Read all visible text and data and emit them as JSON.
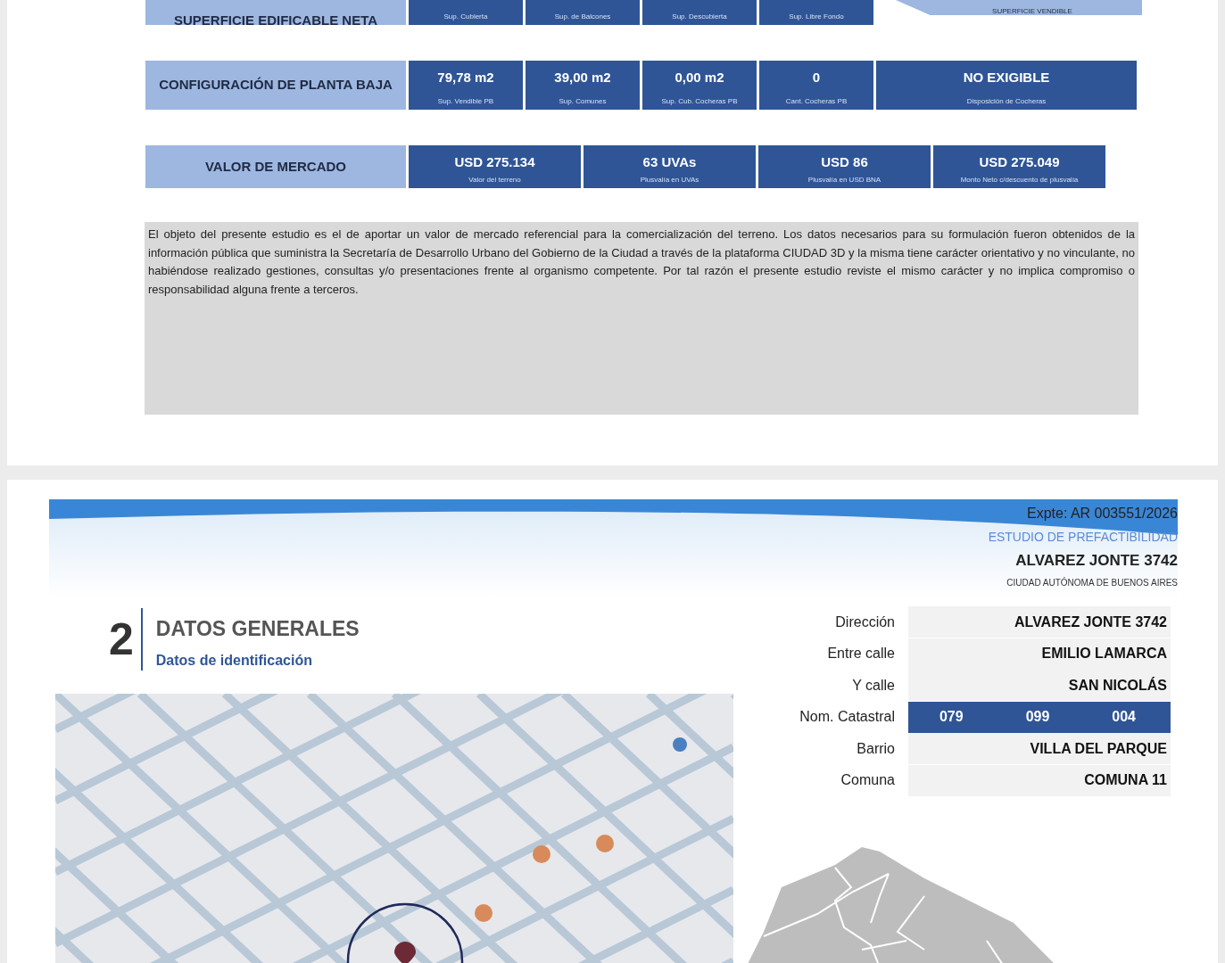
{
  "summary_rows": [
    {
      "label": "SUPERFICIE EDIFICABLE NETA",
      "cells": [
        {
          "caption": "Sup. Cubierta"
        },
        {
          "caption": "Sup. de Balcones"
        },
        {
          "caption": "Sup. Descubierta"
        },
        {
          "caption": "Sup. Libre Fondo"
        }
      ],
      "tag": "SUPERFICIE VENDIBLE"
    },
    {
      "label": "CONFIGURACIÓN DE PLANTA BAJA",
      "cells": [
        {
          "value": "79,78 m2",
          "caption": "Sup. Vendible PB"
        },
        {
          "value": "39,00 m2",
          "caption": "Sup. Comunes"
        },
        {
          "value": "0,00 m2",
          "caption": "Sup. Cub. Cocheras  PB"
        },
        {
          "value": "0",
          "caption": "Cant. Cocheras PB"
        },
        {
          "value": "NO EXIGIBLE",
          "caption": "Disposición de Cocheras"
        }
      ]
    },
    {
      "label": "VALOR DE MERCADO",
      "cells": [
        {
          "value": "USD 275.134",
          "caption": "Valor del terreno"
        },
        {
          "value": "63 UVAs",
          "caption": "Plusvalía en UVAs"
        },
        {
          "value": "USD 86",
          "caption": "Plusvalía en USD  BNA"
        },
        {
          "value": "USD 275.049",
          "caption": "Monto Neto  c/descuento de plusvalía"
        }
      ]
    }
  ],
  "disclaimer": "El objeto del presente estudio es el de aportar un valor de mercado referencial para la comercialización del terreno. Los datos necesarios para su formulación fueron obtenidos de la información pública que suministra la Secretaría de Desarrollo Urbano del Gobierno de la Ciudad a través de la plataforma CIUDAD 3D y la misma tiene carácter orientativo y no vinculante, no habiéndose realizado gestiones, consultas y/o presentaciones frente al organismo competente. Por tal razón el presente estudio reviste el mismo carácter y no implica compromiso o responsabilidad alguna frente a terceros.",
  "header": {
    "file_number": "Expte: AR 003551/2026",
    "study": "ESTUDIO DE PREFACTIBILIDAD",
    "address": "ALVAREZ JONTE 3742",
    "city": "CIUDAD AUTÓNOMA DE BUENOS AIRES"
  },
  "section": {
    "number": "2",
    "title": "DATOS GENERALES",
    "subtitle": "Datos de identificación"
  },
  "fields": [
    {
      "label": "Dirección",
      "values": [
        "ALVAREZ JONTE 3742"
      ],
      "highlighted": false
    },
    {
      "label": "Entre calle",
      "values": [
        "EMILIO LAMARCA"
      ],
      "highlighted": false
    },
    {
      "label": "Y calle",
      "values": [
        "SAN NICOLÁS"
      ],
      "highlighted": false
    },
    {
      "label": "Nom. Catastral",
      "values": [
        "079",
        "099",
        "004"
      ],
      "highlighted": true
    },
    {
      "label": "Barrio",
      "values": [
        "VILLA DEL PARQUE"
      ],
      "highlighted": false
    },
    {
      "label": "Comuna",
      "values": [
        "COMUNA 11"
      ],
      "highlighted": false
    }
  ]
}
